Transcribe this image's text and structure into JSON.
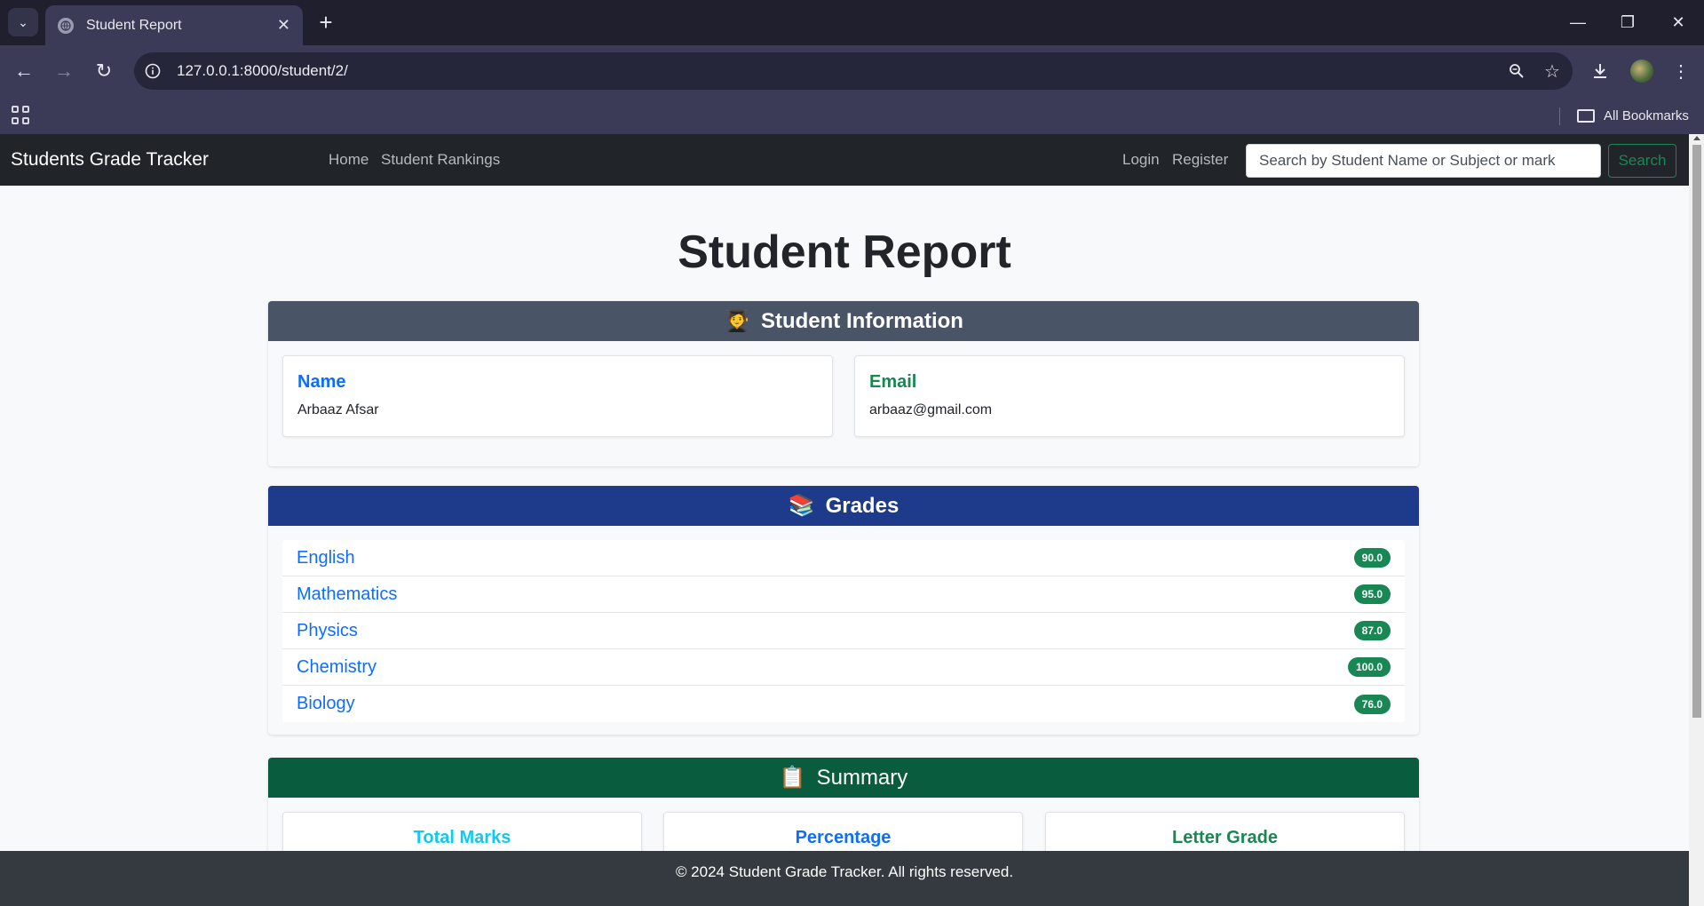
{
  "browser": {
    "tab_title": "Student Report",
    "tab_close": "✕",
    "new_tab": "+",
    "url": "127.0.0.1:8000/student/2/",
    "all_bookmarks": "All Bookmarks",
    "window_controls": {
      "minimize": "—",
      "restore": "❐",
      "close": "✕"
    }
  },
  "navbar": {
    "brand": "Students Grade Tracker",
    "links": {
      "home": "Home",
      "rankings": "Student Rankings",
      "login": "Login",
      "register": "Register"
    },
    "search_placeholder": "Search by Student Name or Subject or mark",
    "search_button": "Search"
  },
  "page": {
    "title": "Student Report",
    "student_info": {
      "header_icon": "🧑‍🎓",
      "header": "Student Information",
      "name_label": "Name",
      "name_value": "Arbaaz Afsar",
      "email_label": "Email",
      "email_value": "arbaaz@gmail.com"
    },
    "grades": {
      "header_icon": "📚",
      "header": "Grades",
      "items": [
        {
          "subject": "English",
          "mark": "90.0"
        },
        {
          "subject": "Mathematics",
          "mark": "95.0"
        },
        {
          "subject": "Physics",
          "mark": "87.0"
        },
        {
          "subject": "Chemistry",
          "mark": "100.0"
        },
        {
          "subject": "Biology",
          "mark": "76.0"
        }
      ]
    },
    "summary": {
      "header_icon": "📋",
      "header": "Summary",
      "total_marks_label": "Total Marks",
      "percentage_label": "Percentage",
      "letter_grade_label": "Letter Grade"
    },
    "footer": "© 2024 Student Grade Tracker. All rights reserved."
  },
  "colors": {
    "navbar_bg": "#212529",
    "student_info_header": "#495467",
    "grades_header": "#1e3a8a",
    "summary_header": "#0a5c3e",
    "name_label": "#0d6efd",
    "email_label": "#198754",
    "total_marks_label": "#0dcaf0",
    "percentage_label": "#0d6efd",
    "letter_grade_label": "#198754",
    "badge": "#198754",
    "footer_bg": "#343a40"
  }
}
